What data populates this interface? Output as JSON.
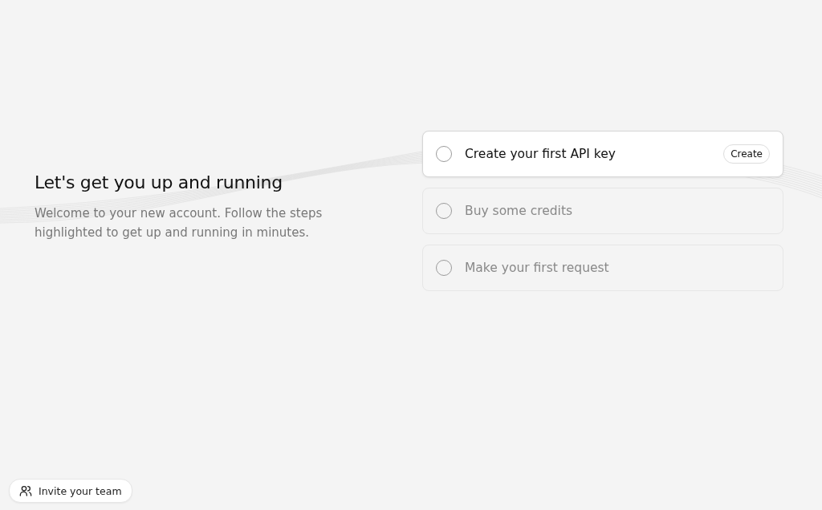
{
  "intro": {
    "title": "Let's get you up and running",
    "text": "Welcome to your new account. Follow the steps highlighted to get up and running in minutes."
  },
  "steps": [
    {
      "label": "Create your first API key",
      "active": true,
      "done": false,
      "action": "Create"
    },
    {
      "label": "Buy some credits",
      "active": false,
      "done": false
    },
    {
      "label": "Make your first request",
      "active": false,
      "done": false
    }
  ],
  "invite_button": "Invite your team"
}
